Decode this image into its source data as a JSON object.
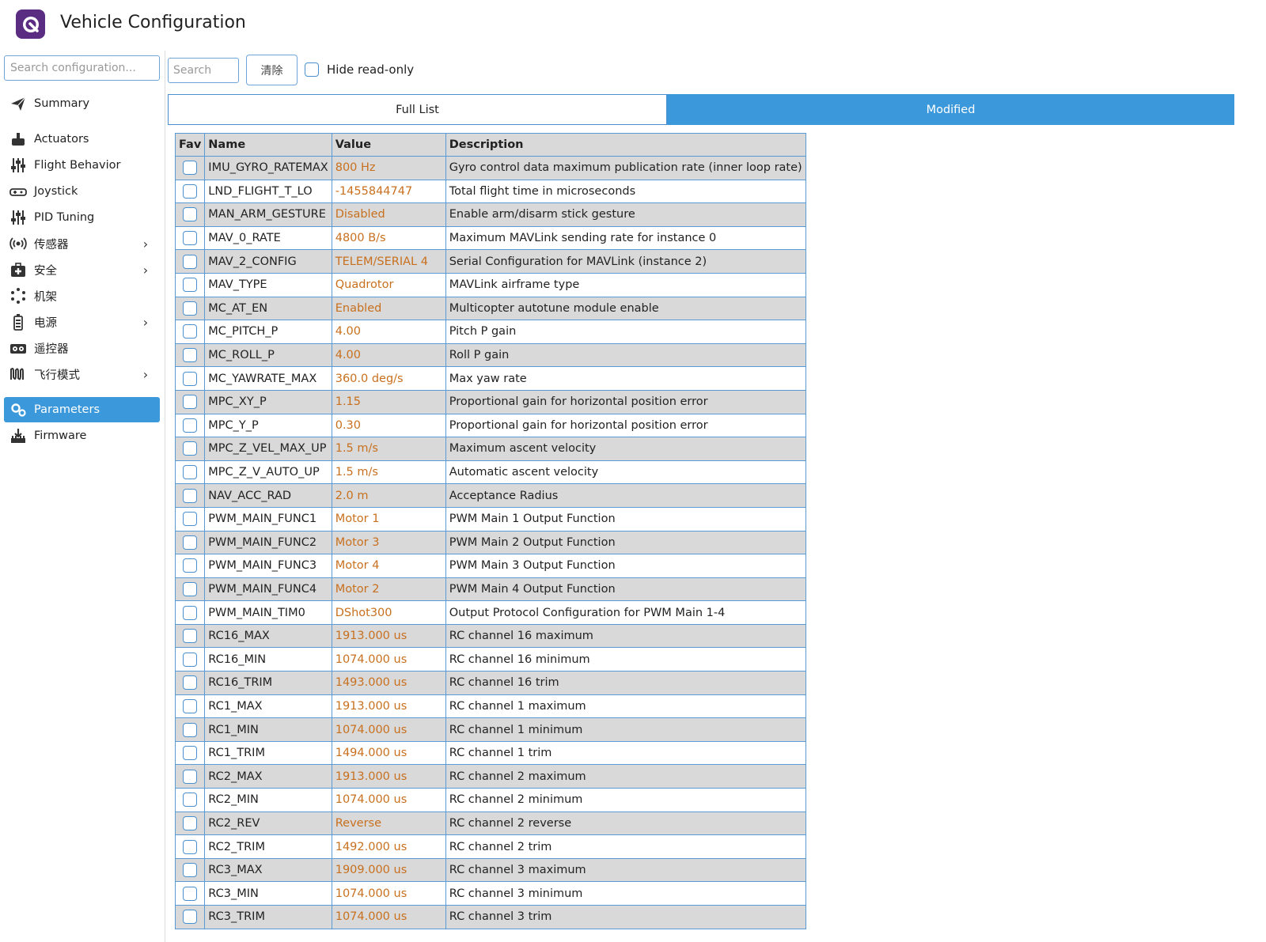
{
  "app": {
    "title": "Vehicle Configuration",
    "logo_icon": "qgc-logo-icon"
  },
  "sidebar": {
    "search_placeholder": "Search configuration...",
    "items": [
      {
        "label": "Summary",
        "icon": "paper-plane-icon",
        "chevron": false,
        "active": false
      },
      {
        "label": "Actuators",
        "icon": "actuator-icon",
        "chevron": false,
        "active": false
      },
      {
        "label": "Flight Behavior",
        "icon": "sliders-icon",
        "chevron": false,
        "active": false
      },
      {
        "label": "Joystick",
        "icon": "gamepad-icon",
        "chevron": false,
        "active": false
      },
      {
        "label": "PID Tuning",
        "icon": "sliders-icon",
        "chevron": false,
        "active": false
      },
      {
        "label": "传感器",
        "icon": "broadcast-icon",
        "chevron": true,
        "active": false
      },
      {
        "label": "安全",
        "icon": "first-aid-icon",
        "chevron": true,
        "active": false
      },
      {
        "label": "机架",
        "icon": "airframe-icon",
        "chevron": false,
        "active": false
      },
      {
        "label": "电源",
        "icon": "battery-icon",
        "chevron": true,
        "active": false
      },
      {
        "label": "遥控器",
        "icon": "radio-icon",
        "chevron": false,
        "active": false
      },
      {
        "label": "飞行模式",
        "icon": "wave-icon",
        "chevron": true,
        "active": false
      },
      {
        "label": "Parameters",
        "icon": "gears-icon",
        "chevron": false,
        "active": true
      },
      {
        "label": "Firmware",
        "icon": "firmware-icon",
        "chevron": false,
        "active": false
      }
    ]
  },
  "toolbar": {
    "search_placeholder": "Search",
    "clear_label": "清除",
    "hide_readonly_label": "Hide read-only"
  },
  "tabs": {
    "full_list": "Full List",
    "modified": "Modified",
    "active": "Modified"
  },
  "table": {
    "headers": {
      "fav": "Fav",
      "name": "Name",
      "value": "Value",
      "description": "Description"
    },
    "rows": [
      {
        "name": "IMU_GYRO_RATEMAX",
        "value": "800 Hz",
        "description": "Gyro control data maximum publication rate (inner loop rate)"
      },
      {
        "name": "LND_FLIGHT_T_LO",
        "value": "-1455844747",
        "description": "Total flight time in microseconds"
      },
      {
        "name": "MAN_ARM_GESTURE",
        "value": "Disabled",
        "description": "Enable arm/disarm stick gesture"
      },
      {
        "name": "MAV_0_RATE",
        "value": "4800 B/s",
        "description": "Maximum MAVLink sending rate for instance 0"
      },
      {
        "name": "MAV_2_CONFIG",
        "value": "TELEM/SERIAL 4",
        "description": "Serial Configuration for MAVLink (instance 2)"
      },
      {
        "name": "MAV_TYPE",
        "value": "Quadrotor",
        "description": "MAVLink airframe type"
      },
      {
        "name": "MC_AT_EN",
        "value": "Enabled",
        "description": "Multicopter autotune module enable"
      },
      {
        "name": "MC_PITCH_P",
        "value": "4.00",
        "description": "Pitch P gain"
      },
      {
        "name": "MC_ROLL_P",
        "value": "4.00",
        "description": "Roll P gain"
      },
      {
        "name": "MC_YAWRATE_MAX",
        "value": "360.0 deg/s",
        "description": "Max yaw rate"
      },
      {
        "name": "MPC_XY_P",
        "value": "1.15",
        "description": "Proportional gain for horizontal position error"
      },
      {
        "name": "MPC_Y_P",
        "value": "0.30",
        "description": "Proportional gain for horizontal position error"
      },
      {
        "name": "MPC_Z_VEL_MAX_UP",
        "value": "1.5 m/s",
        "description": "Maximum ascent velocity"
      },
      {
        "name": "MPC_Z_V_AUTO_UP",
        "value": "1.5 m/s",
        "description": "Automatic ascent velocity"
      },
      {
        "name": "NAV_ACC_RAD",
        "value": "2.0 m",
        "description": "Acceptance Radius"
      },
      {
        "name": "PWM_MAIN_FUNC1",
        "value": "Motor 1",
        "description": "PWM Main 1 Output Function"
      },
      {
        "name": "PWM_MAIN_FUNC2",
        "value": "Motor 3",
        "description": "PWM Main 2 Output Function"
      },
      {
        "name": "PWM_MAIN_FUNC3",
        "value": "Motor 4",
        "description": "PWM Main 3 Output Function"
      },
      {
        "name": "PWM_MAIN_FUNC4",
        "value": "Motor 2",
        "description": "PWM Main 4 Output Function"
      },
      {
        "name": "PWM_MAIN_TIM0",
        "value": "DShot300",
        "description": "Output Protocol Configuration for PWM Main 1-4"
      },
      {
        "name": "RC16_MAX",
        "value": "1913.000 us",
        "description": "RC channel 16 maximum"
      },
      {
        "name": "RC16_MIN",
        "value": "1074.000 us",
        "description": "RC channel 16 minimum"
      },
      {
        "name": "RC16_TRIM",
        "value": "1493.000 us",
        "description": "RC channel 16 trim"
      },
      {
        "name": "RC1_MAX",
        "value": "1913.000 us",
        "description": "RC channel 1 maximum"
      },
      {
        "name": "RC1_MIN",
        "value": "1074.000 us",
        "description": "RC channel 1 minimum"
      },
      {
        "name": "RC1_TRIM",
        "value": "1494.000 us",
        "description": "RC channel 1 trim"
      },
      {
        "name": "RC2_MAX",
        "value": "1913.000 us",
        "description": "RC channel 2 maximum"
      },
      {
        "name": "RC2_MIN",
        "value": "1074.000 us",
        "description": "RC channel 2 minimum"
      },
      {
        "name": "RC2_REV",
        "value": "Reverse",
        "description": "RC channel 2 reverse"
      },
      {
        "name": "RC2_TRIM",
        "value": "1492.000 us",
        "description": "RC channel 2 trim"
      },
      {
        "name": "RC3_MAX",
        "value": "1909.000 us",
        "description": "RC channel 3 maximum"
      },
      {
        "name": "RC3_MIN",
        "value": "1074.000 us",
        "description": "RC channel 3 minimum"
      },
      {
        "name": "RC3_TRIM",
        "value": "1074.000 us",
        "description": "RC channel 3 trim"
      }
    ]
  },
  "colors": {
    "accent": "#3a98db",
    "value_text": "#c8701e",
    "row_alt": "#d9d9d9",
    "border": "#5a9bd5",
    "logo_bg": "#5a2d82"
  }
}
